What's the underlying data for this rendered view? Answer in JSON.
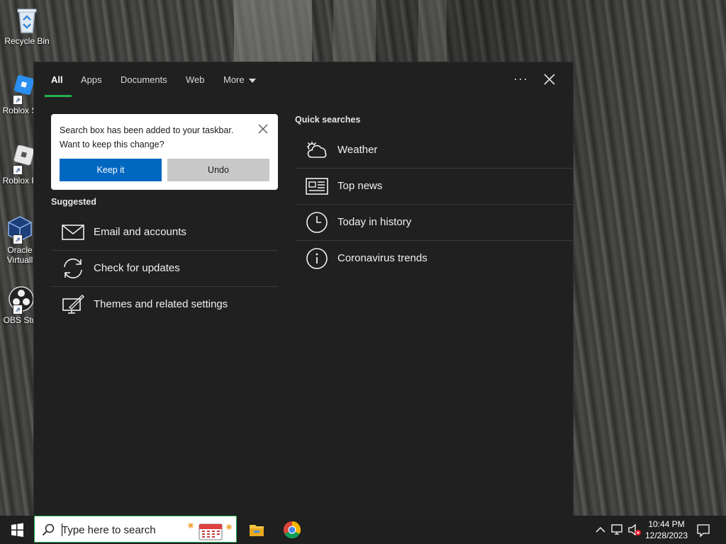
{
  "desktop": {
    "icons": [
      {
        "label": "Recycle Bin",
        "icon": "recycle-bin-icon"
      },
      {
        "label": "Roblox S",
        "icon": "roblox-studio-icon"
      },
      {
        "label": "Roblox P",
        "icon": "roblox-player-icon"
      },
      {
        "label": "Oracle",
        "label2": "Virtuall",
        "icon": "virtualbox-icon"
      },
      {
        "label": "OBS Stu",
        "icon": "obs-studio-icon"
      }
    ]
  },
  "search_panel": {
    "tabs": [
      {
        "label": "All",
        "active": true
      },
      {
        "label": "Apps"
      },
      {
        "label": "Documents"
      },
      {
        "label": "Web"
      },
      {
        "label": "More"
      }
    ],
    "options_glyph": "···",
    "notice": {
      "message_line1": "Search box has been added to your taskbar.",
      "message_line2": "Want to keep this change?",
      "keep_label": "Keep it",
      "undo_label": "Undo"
    },
    "suggested": {
      "title": "Suggested",
      "items": [
        {
          "label": "Email and accounts",
          "icon": "mail-icon"
        },
        {
          "label": "Check for updates",
          "icon": "sync-icon"
        },
        {
          "label": "Themes and related settings",
          "icon": "themes-icon"
        }
      ]
    },
    "quick_searches": {
      "title": "Quick searches",
      "items": [
        {
          "label": "Weather",
          "icon": "weather-icon"
        },
        {
          "label": "Top news",
          "icon": "news-icon"
        },
        {
          "label": "Today in history",
          "icon": "clock-icon"
        },
        {
          "label": "Coronavirus trends",
          "icon": "info-icon"
        }
      ]
    }
  },
  "taskbar": {
    "search_placeholder": "Type here to search",
    "time": "10:44 PM",
    "date": "12/28/2023",
    "accent": "#26b050",
    "keep_button_color": "#0067c0"
  }
}
